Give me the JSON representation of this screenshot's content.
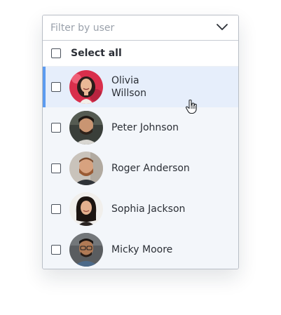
{
  "filter": {
    "placeholder": "Filter by user",
    "icon": "chevron-down-icon",
    "select_all_label": "Select all"
  },
  "users": [
    {
      "first": "Olivia",
      "last": "Willson",
      "selected": false,
      "highlighted": true,
      "avatar": "avatar-olivia"
    },
    {
      "name": "Peter Johnson",
      "selected": false,
      "avatar": "avatar-peter"
    },
    {
      "name": "Roger Anderson",
      "selected": false,
      "avatar": "avatar-roger"
    },
    {
      "name": "Sophia Jackson",
      "selected": false,
      "avatar": "avatar-sophia"
    },
    {
      "name": "Micky Moore",
      "selected": false,
      "avatar": "avatar-micky"
    }
  ],
  "colors": {
    "accent": "#5c9bf0",
    "highlight_bg": "#e6eefb",
    "list_bg": "#f3f6fa"
  }
}
